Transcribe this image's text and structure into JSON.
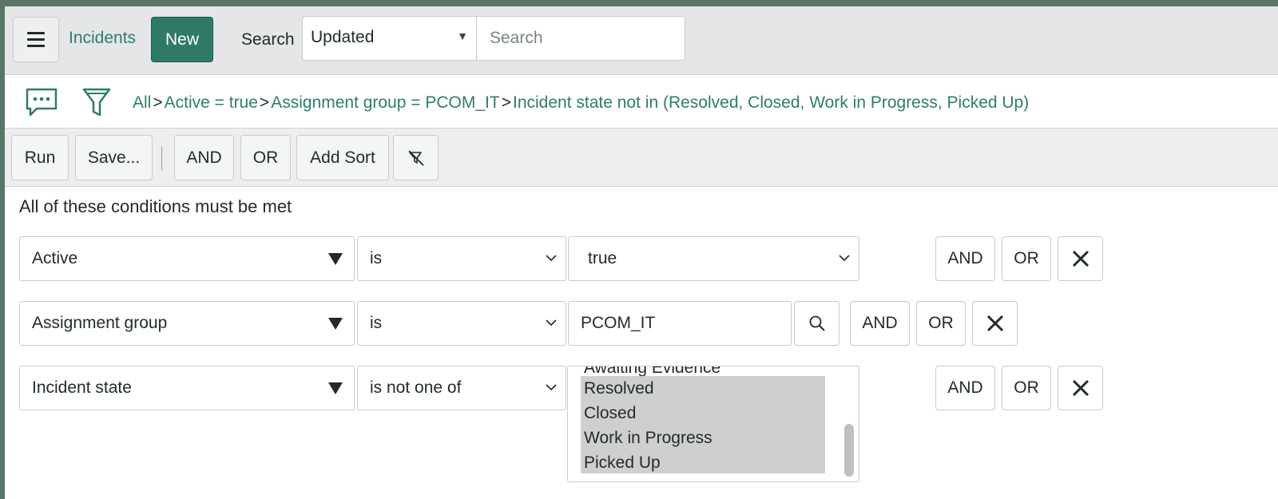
{
  "header": {
    "app_title": "Incidents",
    "new_label": "New",
    "search_label": "Search",
    "search_field_selected": "Updated",
    "search_placeholder": "Search"
  },
  "breadcrumb": {
    "items": [
      "All",
      "Active = true",
      "Assignment group = PCOM_IT",
      "Incident state not in (Resolved, Closed, Work in Progress, Picked Up)"
    ],
    "separator": ">"
  },
  "toolbar": {
    "run_label": "Run",
    "save_label": "Save...",
    "and_label": "AND",
    "or_label": "OR",
    "add_sort_label": "Add Sort"
  },
  "conditions": {
    "title": "All of these conditions must be met",
    "rows": [
      {
        "field": "Active",
        "operator": "is",
        "value": "true",
        "and_label": "AND",
        "or_label": "OR"
      },
      {
        "field": "Assignment group",
        "operator": "is",
        "value": "PCOM_IT",
        "and_label": "AND",
        "or_label": "OR"
      },
      {
        "field": "Incident state",
        "operator": "is not one of",
        "and_label": "AND",
        "or_label": "OR",
        "options_partial": "Awaiting Evidence",
        "selected_options": [
          "Resolved",
          "Closed",
          "Work in Progress",
          "Picked Up"
        ]
      }
    ]
  },
  "colors": {
    "accent": "#2e7a66",
    "link": "#2e7d6b",
    "frame": "#5b7666"
  },
  "icons": {
    "menu": "hamburger-icon",
    "comment": "comment-icon",
    "filter": "filter-icon",
    "clear_filter": "clear-filter-icon",
    "lookup": "search-icon",
    "delete": "close-icon"
  }
}
